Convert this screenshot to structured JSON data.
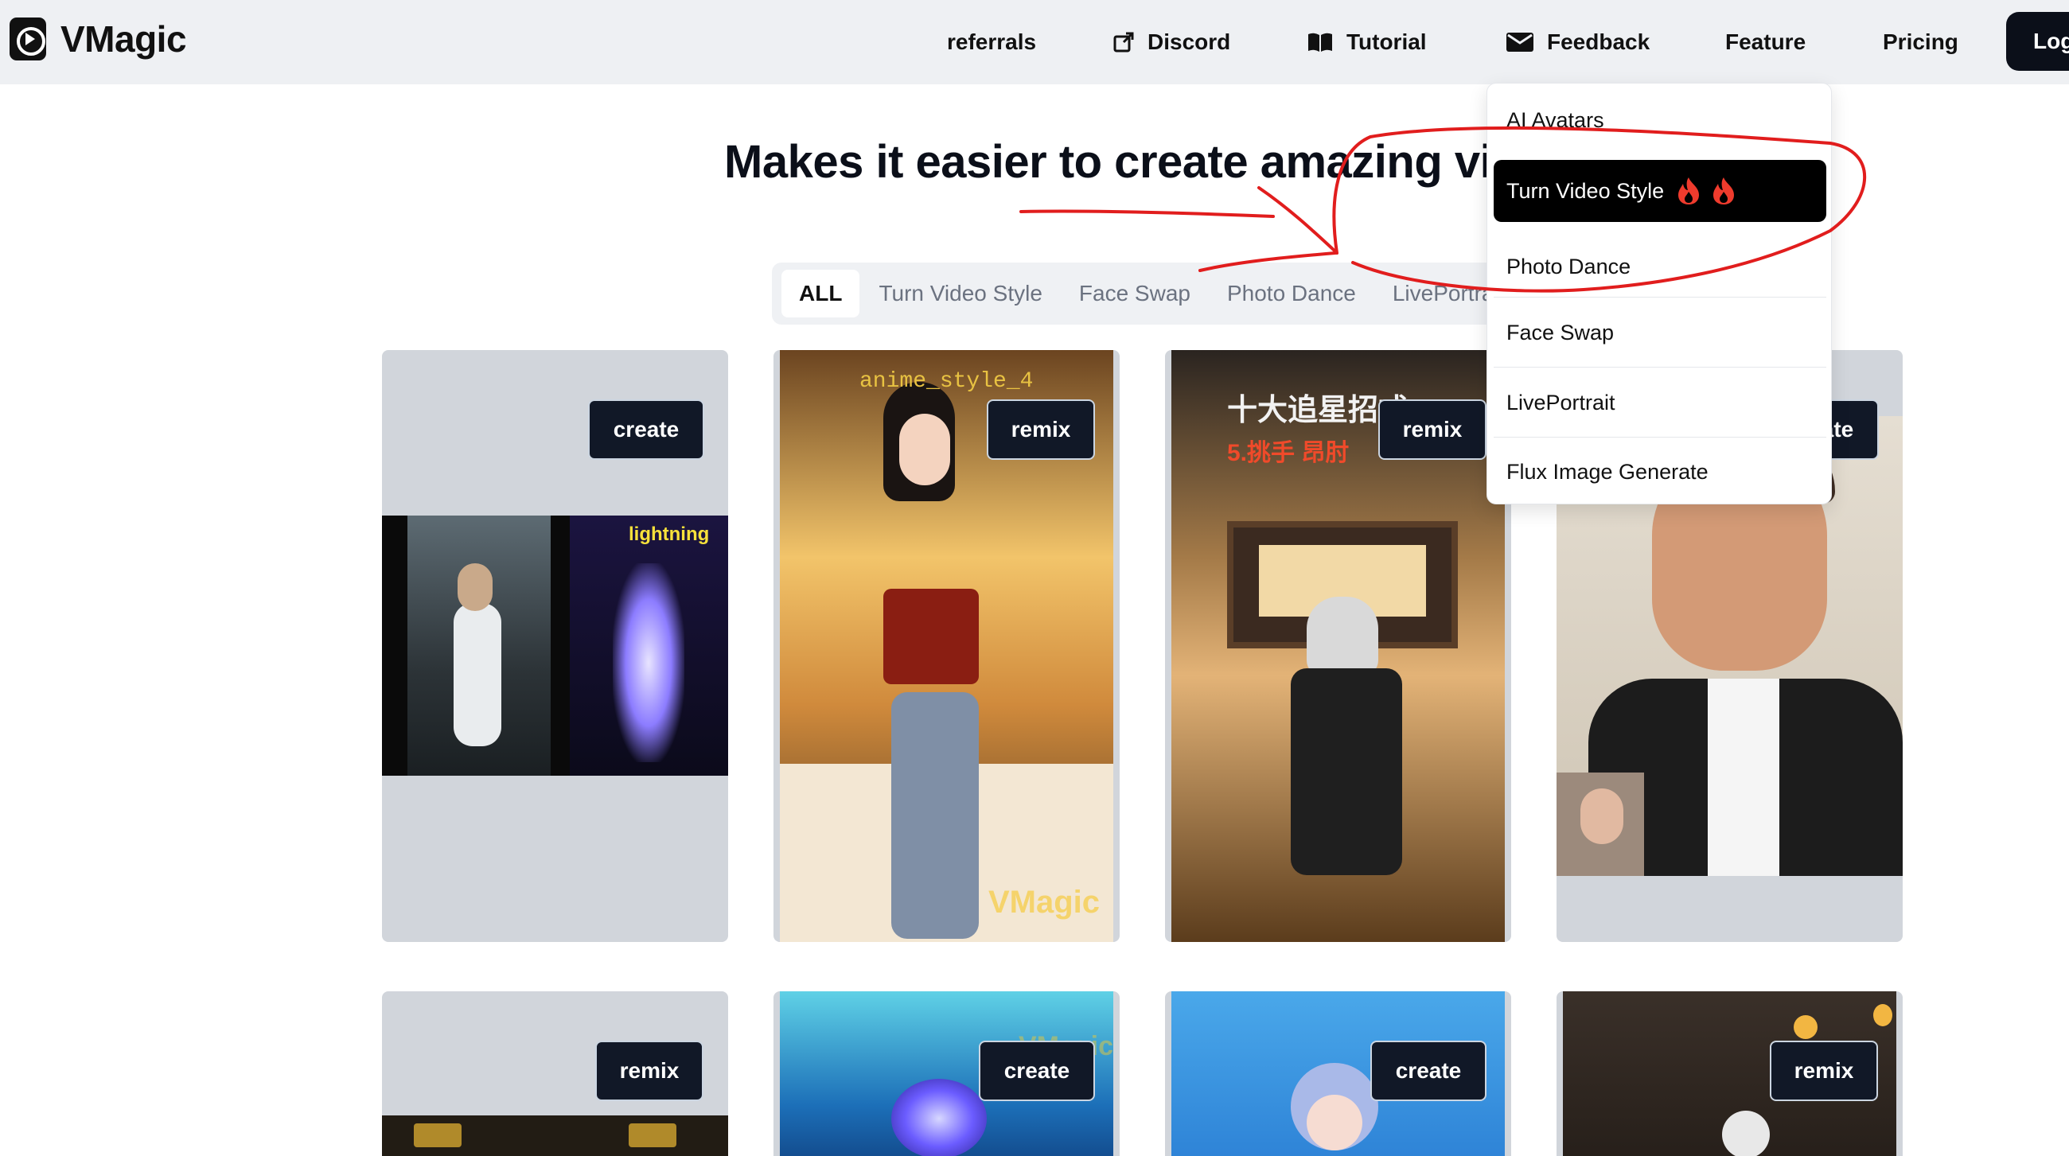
{
  "header": {
    "brand": "VMagic",
    "nav": [
      {
        "label": "referrals",
        "icon": ""
      },
      {
        "label": "Discord",
        "icon": "external-link-icon"
      },
      {
        "label": "Tutorial",
        "icon": "book-open-icon"
      },
      {
        "label": "Feedback",
        "icon": "envelope-icon"
      },
      {
        "label": "Feature",
        "icon": ""
      },
      {
        "label": "Pricing",
        "icon": ""
      }
    ],
    "login_label": "Log"
  },
  "hero": {
    "title": "Makes it easier to create amazing vid"
  },
  "tabs": [
    "ALL",
    "Turn Video Style",
    "Face Swap",
    "Photo Dance",
    "LivePortrait"
  ],
  "active_tab": "ALL",
  "dropdown": {
    "items": [
      "AI Avatars",
      "Turn Video Style",
      "Photo Dance",
      "Face Swap",
      "LivePortrait",
      "Flux Image Generate"
    ],
    "active_item": "Turn Video Style",
    "active_badge_icon": "fire-icon"
  },
  "cards": [
    {
      "button": "create",
      "overlay_text": "lightning"
    },
    {
      "button": "remix",
      "overlay_text": "anime_style_4",
      "watermark": "VMagic"
    },
    {
      "button": "remix",
      "overlay_text": "十大追星招式",
      "overlay_text_2": "5.挑手 昂肘"
    },
    {
      "button": "create"
    },
    {
      "button": "remix"
    },
    {
      "button": "create",
      "watermark": "VMagic"
    },
    {
      "button": "create"
    },
    {
      "button": "remix"
    }
  ],
  "colors": {
    "header_bg": "#eef0f3",
    "button_dark": "#111827",
    "annotation_red": "#e11d1d",
    "card_placeholder": "#d1d5db"
  }
}
